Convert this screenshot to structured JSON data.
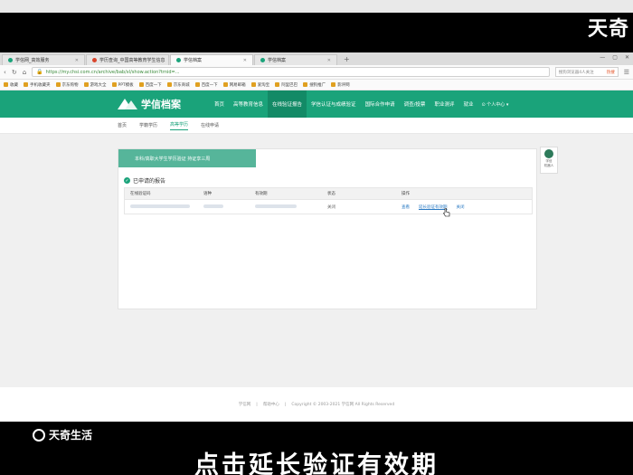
{
  "watermark_top": "天奇",
  "tabs": [
    {
      "label": "学信网_高效服务",
      "active": false
    },
    {
      "label": "学历查询_中国高等教育学生信息",
      "active": false
    },
    {
      "label": "学信档案",
      "active": true
    },
    {
      "label": "学信档案",
      "active": false
    }
  ],
  "address": {
    "url": "https://my.chsi.com.cn/archive/bab/xl/show.action?trnid=...",
    "search_placeholder": "搜狗浏览器4人关注",
    "search_hot": "热搜"
  },
  "bookmarks": [
    "收藏",
    "手机收藏夹",
    "京东购物",
    "游戏大全",
    "PPT模板",
    "百度一下",
    "京东商城",
    "百度一下",
    "网易邮箱",
    "爱淘宝",
    "阿里巴巴",
    "搜狗推广",
    "影评网"
  ],
  "site": {
    "logo_text": "学信档案",
    "nav": [
      {
        "label": "首页",
        "active": false
      },
      {
        "label": "高等教育信息",
        "active": false
      },
      {
        "label": "在线验证报告",
        "active": true
      },
      {
        "label": "学信认证与成绩验证",
        "active": false
      },
      {
        "label": "国际合作申请",
        "active": false
      },
      {
        "label": "调查/投票",
        "active": false
      },
      {
        "label": "职业测评",
        "active": false
      },
      {
        "label": "就业",
        "active": false
      }
    ],
    "user": "个人中心"
  },
  "subnav": [
    {
      "label": "首页",
      "active": false
    },
    {
      "label": "学籍学历",
      "active": false
    },
    {
      "label": "高等学历",
      "active": true
    },
    {
      "label": "在线申请",
      "active": false
    }
  ],
  "card": {
    "notice": "本科/高职大学生学历验证 持证享三周",
    "section_title": "已申请的报告",
    "table": {
      "headers": [
        "在线验证码",
        "语种",
        "有效期",
        "状态",
        "操作"
      ],
      "rows": [
        {
          "status": "关闭",
          "actions": [
            "查看",
            "延长验证有效期",
            "关闭"
          ]
        }
      ]
    }
  },
  "side_help": {
    "line1": "学信",
    "line2": "机器人"
  },
  "footer": {
    "items": [
      "学信网",
      "帮助中心",
      "Copyright © 2003-2021 学信网 All Rights Reserved"
    ]
  },
  "brand_watermark": "天奇生活",
  "subtitle": "点击延长验证有效期",
  "colors": {
    "brand": "#1aa37a",
    "link": "#2b7bc4",
    "notice": "#56b59a"
  }
}
